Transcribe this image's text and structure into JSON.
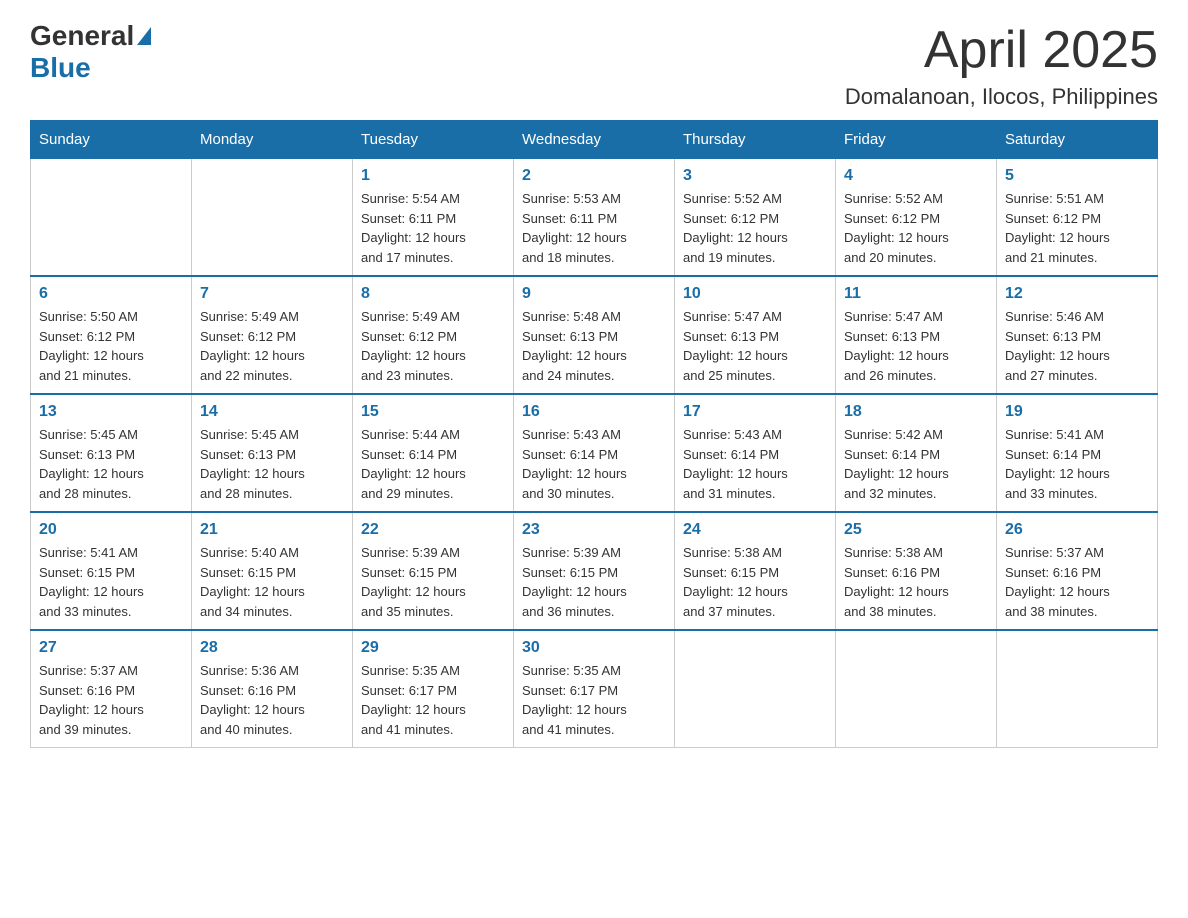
{
  "header": {
    "logo": {
      "general": "General",
      "blue": "Blue"
    },
    "title": "April 2025",
    "location": "Domalanoan, Ilocos, Philippines"
  },
  "days_of_week": [
    "Sunday",
    "Monday",
    "Tuesday",
    "Wednesday",
    "Thursday",
    "Friday",
    "Saturday"
  ],
  "weeks": [
    [
      {
        "day": "",
        "info": ""
      },
      {
        "day": "",
        "info": ""
      },
      {
        "day": "1",
        "info": "Sunrise: 5:54 AM\nSunset: 6:11 PM\nDaylight: 12 hours\nand 17 minutes."
      },
      {
        "day": "2",
        "info": "Sunrise: 5:53 AM\nSunset: 6:11 PM\nDaylight: 12 hours\nand 18 minutes."
      },
      {
        "day": "3",
        "info": "Sunrise: 5:52 AM\nSunset: 6:12 PM\nDaylight: 12 hours\nand 19 minutes."
      },
      {
        "day": "4",
        "info": "Sunrise: 5:52 AM\nSunset: 6:12 PM\nDaylight: 12 hours\nand 20 minutes."
      },
      {
        "day": "5",
        "info": "Sunrise: 5:51 AM\nSunset: 6:12 PM\nDaylight: 12 hours\nand 21 minutes."
      }
    ],
    [
      {
        "day": "6",
        "info": "Sunrise: 5:50 AM\nSunset: 6:12 PM\nDaylight: 12 hours\nand 21 minutes."
      },
      {
        "day": "7",
        "info": "Sunrise: 5:49 AM\nSunset: 6:12 PM\nDaylight: 12 hours\nand 22 minutes."
      },
      {
        "day": "8",
        "info": "Sunrise: 5:49 AM\nSunset: 6:12 PM\nDaylight: 12 hours\nand 23 minutes."
      },
      {
        "day": "9",
        "info": "Sunrise: 5:48 AM\nSunset: 6:13 PM\nDaylight: 12 hours\nand 24 minutes."
      },
      {
        "day": "10",
        "info": "Sunrise: 5:47 AM\nSunset: 6:13 PM\nDaylight: 12 hours\nand 25 minutes."
      },
      {
        "day": "11",
        "info": "Sunrise: 5:47 AM\nSunset: 6:13 PM\nDaylight: 12 hours\nand 26 minutes."
      },
      {
        "day": "12",
        "info": "Sunrise: 5:46 AM\nSunset: 6:13 PM\nDaylight: 12 hours\nand 27 minutes."
      }
    ],
    [
      {
        "day": "13",
        "info": "Sunrise: 5:45 AM\nSunset: 6:13 PM\nDaylight: 12 hours\nand 28 minutes."
      },
      {
        "day": "14",
        "info": "Sunrise: 5:45 AM\nSunset: 6:13 PM\nDaylight: 12 hours\nand 28 minutes."
      },
      {
        "day": "15",
        "info": "Sunrise: 5:44 AM\nSunset: 6:14 PM\nDaylight: 12 hours\nand 29 minutes."
      },
      {
        "day": "16",
        "info": "Sunrise: 5:43 AM\nSunset: 6:14 PM\nDaylight: 12 hours\nand 30 minutes."
      },
      {
        "day": "17",
        "info": "Sunrise: 5:43 AM\nSunset: 6:14 PM\nDaylight: 12 hours\nand 31 minutes."
      },
      {
        "day": "18",
        "info": "Sunrise: 5:42 AM\nSunset: 6:14 PM\nDaylight: 12 hours\nand 32 minutes."
      },
      {
        "day": "19",
        "info": "Sunrise: 5:41 AM\nSunset: 6:14 PM\nDaylight: 12 hours\nand 33 minutes."
      }
    ],
    [
      {
        "day": "20",
        "info": "Sunrise: 5:41 AM\nSunset: 6:15 PM\nDaylight: 12 hours\nand 33 minutes."
      },
      {
        "day": "21",
        "info": "Sunrise: 5:40 AM\nSunset: 6:15 PM\nDaylight: 12 hours\nand 34 minutes."
      },
      {
        "day": "22",
        "info": "Sunrise: 5:39 AM\nSunset: 6:15 PM\nDaylight: 12 hours\nand 35 minutes."
      },
      {
        "day": "23",
        "info": "Sunrise: 5:39 AM\nSunset: 6:15 PM\nDaylight: 12 hours\nand 36 minutes."
      },
      {
        "day": "24",
        "info": "Sunrise: 5:38 AM\nSunset: 6:15 PM\nDaylight: 12 hours\nand 37 minutes."
      },
      {
        "day": "25",
        "info": "Sunrise: 5:38 AM\nSunset: 6:16 PM\nDaylight: 12 hours\nand 38 minutes."
      },
      {
        "day": "26",
        "info": "Sunrise: 5:37 AM\nSunset: 6:16 PM\nDaylight: 12 hours\nand 38 minutes."
      }
    ],
    [
      {
        "day": "27",
        "info": "Sunrise: 5:37 AM\nSunset: 6:16 PM\nDaylight: 12 hours\nand 39 minutes."
      },
      {
        "day": "28",
        "info": "Sunrise: 5:36 AM\nSunset: 6:16 PM\nDaylight: 12 hours\nand 40 minutes."
      },
      {
        "day": "29",
        "info": "Sunrise: 5:35 AM\nSunset: 6:17 PM\nDaylight: 12 hours\nand 41 minutes."
      },
      {
        "day": "30",
        "info": "Sunrise: 5:35 AM\nSunset: 6:17 PM\nDaylight: 12 hours\nand 41 minutes."
      },
      {
        "day": "",
        "info": ""
      },
      {
        "day": "",
        "info": ""
      },
      {
        "day": "",
        "info": ""
      }
    ]
  ]
}
